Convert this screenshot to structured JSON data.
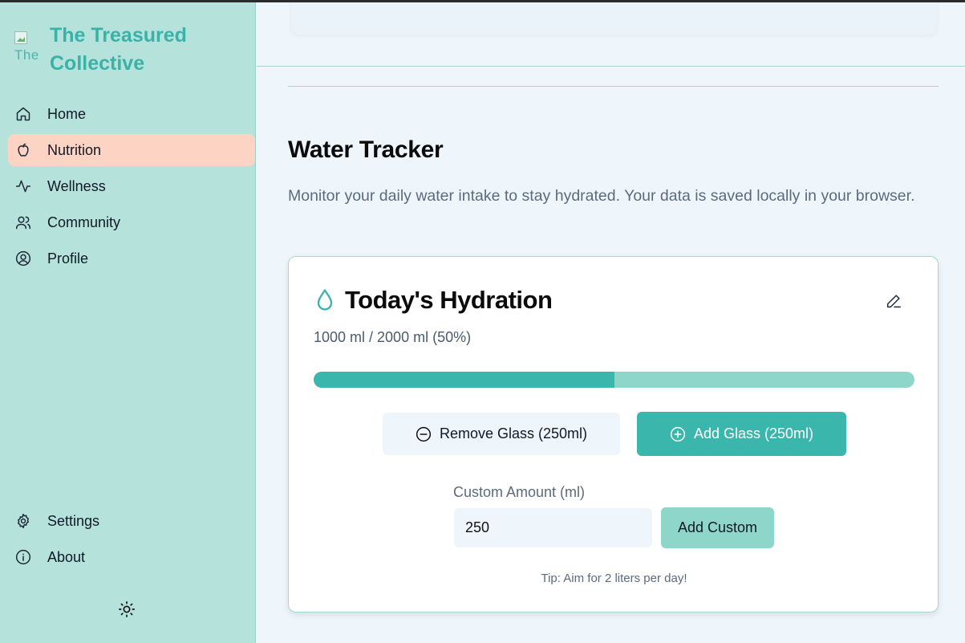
{
  "brand": {
    "title": "The Treasured Collective",
    "logo_alt": "The"
  },
  "sidebar": {
    "items": [
      {
        "label": "Home",
        "icon": "home-icon"
      },
      {
        "label": "Nutrition",
        "icon": "apple-icon",
        "active": true
      },
      {
        "label": "Wellness",
        "icon": "activity-icon"
      },
      {
        "label": "Community",
        "icon": "users-icon"
      },
      {
        "label": "Profile",
        "icon": "user-circle-icon"
      }
    ],
    "bottom_items": [
      {
        "label": "Settings",
        "icon": "gear-icon"
      },
      {
        "label": "About",
        "icon": "info-icon"
      }
    ],
    "theme_toggle_icon": "sun-icon"
  },
  "page": {
    "title": "Water Tracker",
    "description": "Monitor your daily water intake to stay hydrated. Your data is saved locally in your browser."
  },
  "hydration": {
    "title": "Today's Hydration",
    "progress_text": "1000 ml / 2000 ml (50%)",
    "progress_fraction": 0.5,
    "remove_button": "Remove Glass (250ml)",
    "add_button": "Add Glass (250ml)",
    "custom_label": "Custom Amount (ml)",
    "custom_value": "250",
    "custom_button": "Add Custom",
    "tip": "Tip: Aim for 2 liters per day!"
  },
  "colors": {
    "accent": "#3ab6ac",
    "sidebar_bg": "#b5e3dc",
    "active_nav": "#fdd3c4",
    "progress_track": "#8fd6ca"
  }
}
